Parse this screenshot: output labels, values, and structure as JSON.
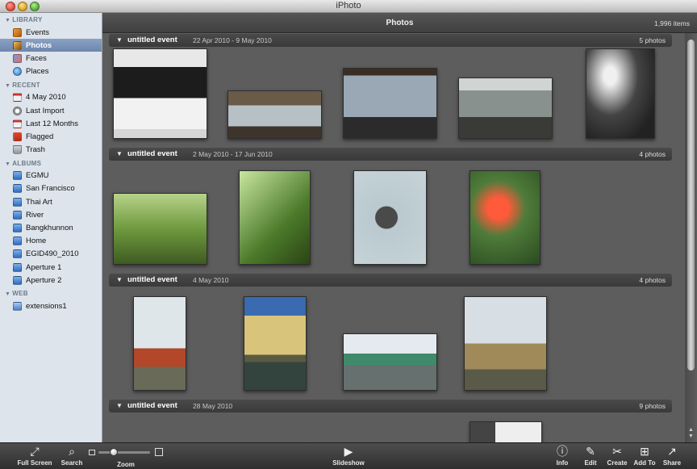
{
  "window": {
    "title": "iPhoto"
  },
  "sidebar": {
    "sections": [
      {
        "label": "LIBRARY",
        "items": [
          {
            "label": "Events",
            "icon": "events-icon"
          },
          {
            "label": "Photos",
            "icon": "photos-icon",
            "selected": true
          },
          {
            "label": "Faces",
            "icon": "faces-icon"
          },
          {
            "label": "Places",
            "icon": "places-icon"
          }
        ]
      },
      {
        "label": "RECENT",
        "items": [
          {
            "label": "4 May 2010",
            "icon": "calendar-icon"
          },
          {
            "label": "Last Import",
            "icon": "clock-icon"
          },
          {
            "label": "Last 12 Months",
            "icon": "calendar-icon"
          },
          {
            "label": "Flagged",
            "icon": "flag-icon"
          },
          {
            "label": "Trash",
            "icon": "trash-icon"
          }
        ]
      },
      {
        "label": "ALBUMS",
        "items": [
          {
            "label": "EGMU",
            "icon": "album-icon"
          },
          {
            "label": "San Francisco",
            "icon": "album-icon"
          },
          {
            "label": "Thai Art",
            "icon": "album-icon"
          },
          {
            "label": "River",
            "icon": "album-icon"
          },
          {
            "label": "Bangkhunnon",
            "icon": "album-icon"
          },
          {
            "label": "Home",
            "icon": "album-icon"
          },
          {
            "label": "EGID490_2010",
            "icon": "album-icon"
          },
          {
            "label": "Aperture 1",
            "icon": "album-icon"
          },
          {
            "label": "Aperture 2",
            "icon": "album-icon"
          }
        ]
      },
      {
        "label": "WEB",
        "items": [
          {
            "label": "extensions1",
            "icon": "web-gallery-icon"
          }
        ]
      }
    ]
  },
  "header": {
    "title": "Photos",
    "count": "1,996 items"
  },
  "events": [
    {
      "name": "untitled event",
      "date": "22 Apr 2010 - 9 May 2010",
      "count": "5 photos"
    },
    {
      "name": "untitled event",
      "date": "2 May 2010 - 17 Jun 2010",
      "count": "4 photos"
    },
    {
      "name": "untitled event",
      "date": "4 May 2010",
      "count": "4 photos"
    },
    {
      "name": "untitled event",
      "date": "28 May 2010",
      "count": "9 photos"
    }
  ],
  "toolbar": {
    "full_screen": "Full Screen",
    "search": "Search",
    "zoom": "Zoom",
    "zoom_level": 0.3,
    "slideshow": "Slideshow",
    "info": "Info",
    "edit": "Edit",
    "create": "Create",
    "add_to": "Add To",
    "share": "Share"
  },
  "colors": {
    "selection": "#6d86ad",
    "sidebar_bg": "#dde4ec",
    "main_bg": "#5d5d5d"
  }
}
